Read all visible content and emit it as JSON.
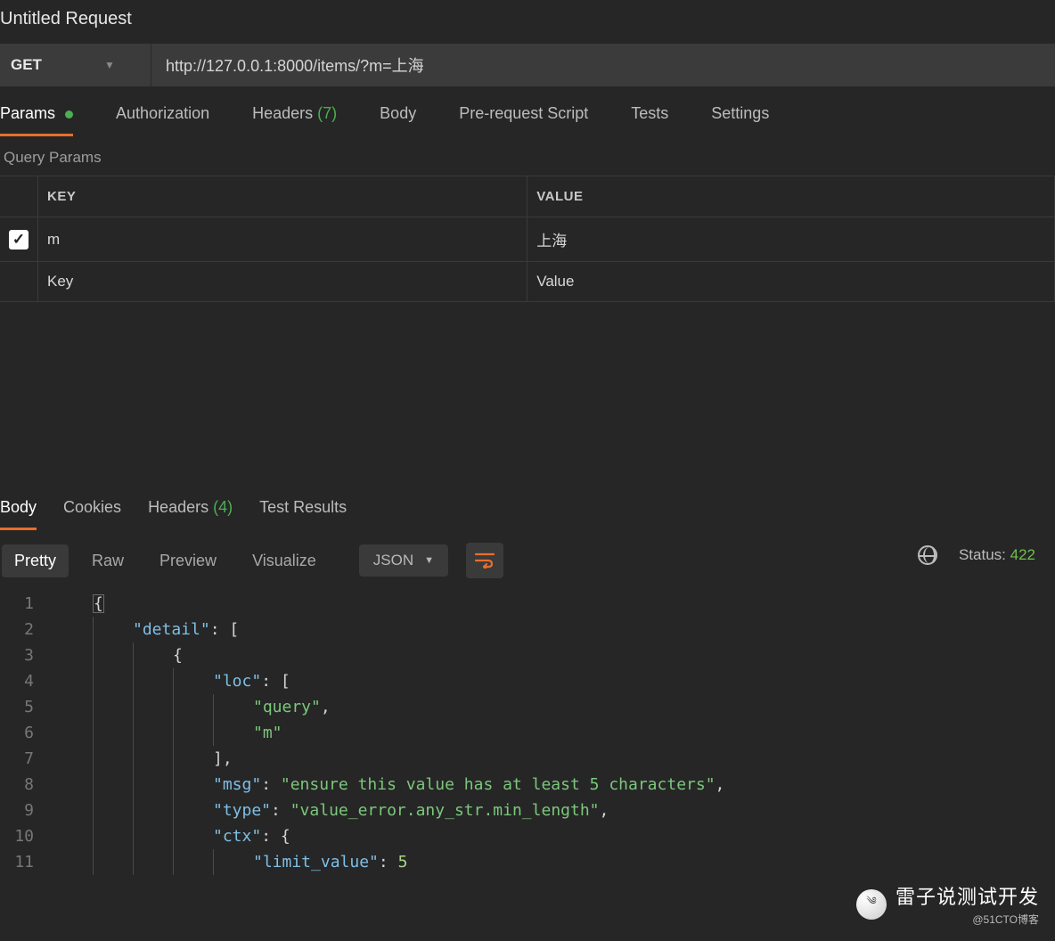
{
  "title": "Untitled Request",
  "request": {
    "method": "GET",
    "url": "http://127.0.0.1:8000/items/?m=上海"
  },
  "tabs": {
    "params": "Params",
    "authorization": "Authorization",
    "headers": "Headers",
    "headers_count": "(7)",
    "body": "Body",
    "prerequest": "Pre-request Script",
    "tests": "Tests",
    "settings": "Settings"
  },
  "query": {
    "section": "Query Params",
    "head_key": "KEY",
    "head_value": "VALUE",
    "rows": [
      {
        "key": "m",
        "value": "上海"
      }
    ],
    "placeholder_key": "Key",
    "placeholder_value": "Value"
  },
  "resp_tabs": {
    "body": "Body",
    "cookies": "Cookies",
    "headers": "Headers",
    "headers_count": "(4)",
    "test_results": "Test Results"
  },
  "status": {
    "label": "Status:",
    "code": "422"
  },
  "viewer": {
    "pretty": "Pretty",
    "raw": "Raw",
    "preview": "Preview",
    "visualize": "Visualize",
    "format": "JSON"
  },
  "json": {
    "k_detail": "\"detail\"",
    "k_loc": "\"loc\"",
    "v_query": "\"query\"",
    "v_m": "\"m\"",
    "k_msg": "\"msg\"",
    "v_msg": "\"ensure this value has at least 5 characters\"",
    "k_type": "\"type\"",
    "v_type": "\"value_error.any_str.min_length\"",
    "k_ctx": "\"ctx\"",
    "k_limit": "\"limit_value\"",
    "v_limit": "5"
  },
  "ln": {
    "1": "1",
    "2": "2",
    "3": "3",
    "4": "4",
    "5": "5",
    "6": "6",
    "7": "7",
    "8": "8",
    "9": "9",
    "10": "10",
    "11": "11"
  },
  "watermark": {
    "text": "雷子说测试开发",
    "sub": "@51CTO博客"
  }
}
